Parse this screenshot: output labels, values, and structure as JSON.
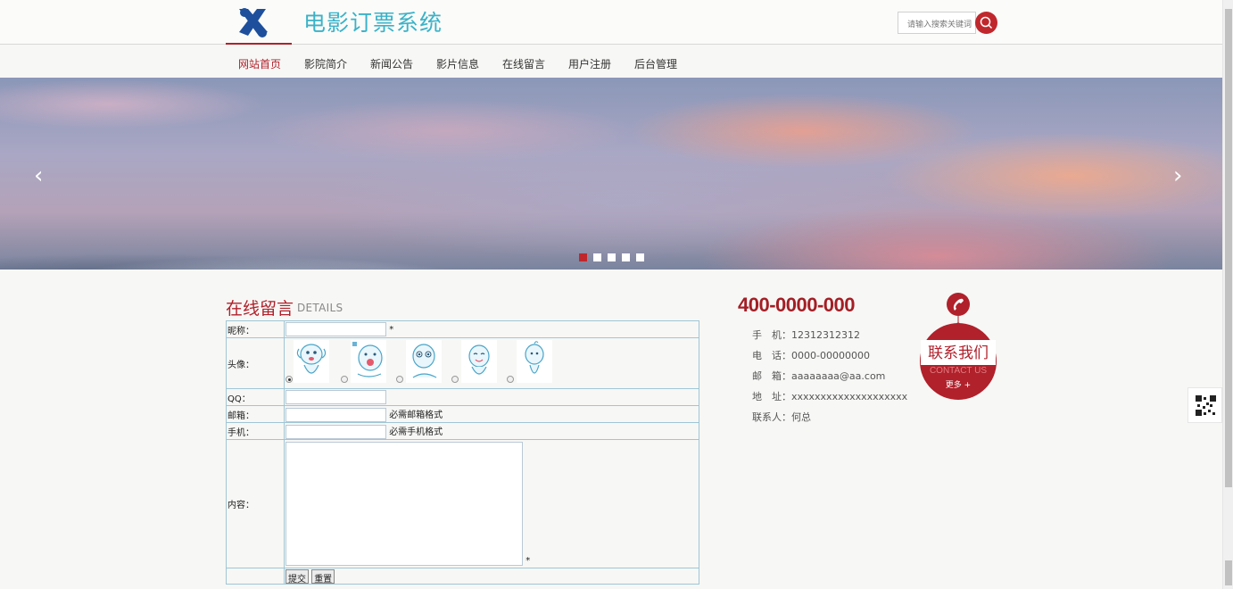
{
  "header": {
    "site_title": "电影订票系统",
    "search_placeholder": "请输入搜索关键词"
  },
  "nav": {
    "items": [
      {
        "label": "网站首页",
        "active": true
      },
      {
        "label": "影院简介",
        "active": false
      },
      {
        "label": "新闻公告",
        "active": false
      },
      {
        "label": "影片信息",
        "active": false
      },
      {
        "label": "在线留言",
        "active": false
      },
      {
        "label": "用户注册",
        "active": false
      },
      {
        "label": "后台管理",
        "active": false
      }
    ]
  },
  "banner": {
    "prev_glyph": "‹",
    "next_glyph": "›",
    "slide_count": 5,
    "active_slide": 1
  },
  "section": {
    "title": "在线留言",
    "subtitle": "DETAILS"
  },
  "form": {
    "nickname_label": "昵称：",
    "nickname_required": "*",
    "avatar_label": "头像：",
    "avatars": [
      "avatar-1",
      "avatar-2",
      "avatar-3",
      "avatar-4",
      "avatar-5"
    ],
    "selected_avatar": 1,
    "qq_label": "QQ：",
    "email_label": "邮箱：",
    "email_hint": "必需邮箱格式",
    "mobile_label": "手机：",
    "mobile_hint": "必需手机格式",
    "content_label": "内容：",
    "content_required": "*",
    "submit_label": "提交",
    "reset_label": "重置"
  },
  "contact": {
    "hotline": "400-0000-000",
    "mobile": "手　机：12312312312",
    "tel": "电　话：0000-00000000",
    "email": "邮　箱：aaaaaaaa@aa.com",
    "address": "地　址：xxxxxxxxxxxxxxxxxxxx",
    "person": "联系人：何总",
    "badge_title": "联系我们",
    "badge_sub": "CONTACT US",
    "badge_more": "更多 +"
  },
  "colors": {
    "brand_red": "#b0212b",
    "title_teal": "#3ab2c8",
    "table_border": "#9fc6d6"
  }
}
